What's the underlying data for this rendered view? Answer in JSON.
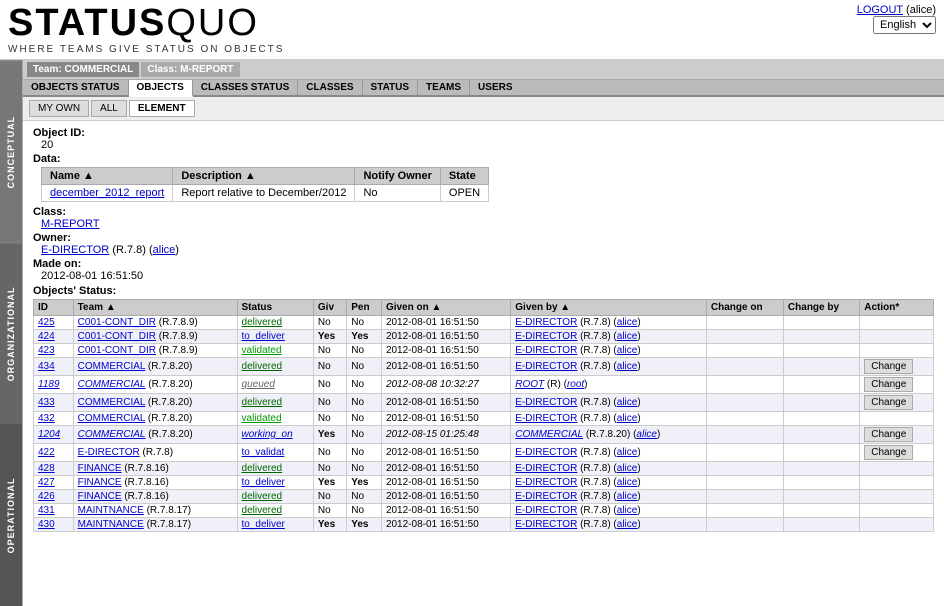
{
  "app": {
    "logo_status": "STATUS",
    "logo_quo": "QUO",
    "tagline": "WHERE TEAMS GIVE STATUS ON OBJECTS",
    "logout_label": "LOGOUT",
    "user": "alice",
    "language": "English"
  },
  "nav_info": {
    "team_label": "Team: COMMERCIAL",
    "class_label": "Class: M-REPORT"
  },
  "nav_tabs": [
    {
      "id": "objects-status",
      "label": "OBJECTS STATUS",
      "active": false
    },
    {
      "id": "objects",
      "label": "OBJECTS",
      "active": true
    },
    {
      "id": "classes-status",
      "label": "CLASSES STATUS",
      "active": false
    },
    {
      "id": "classes",
      "label": "CLASSES",
      "active": false
    },
    {
      "id": "status",
      "label": "STATUS",
      "active": false
    },
    {
      "id": "teams",
      "label": "TEAMS",
      "active": false
    },
    {
      "id": "users",
      "label": "USERS",
      "active": false
    }
  ],
  "sub_tabs": [
    {
      "id": "my-own",
      "label": "MY OWN",
      "active": false
    },
    {
      "id": "all",
      "label": "ALL",
      "active": false
    },
    {
      "id": "element",
      "label": "ELEMENT",
      "active": true
    }
  ],
  "object_detail": {
    "object_id_label": "Object ID:",
    "object_id_value": "20",
    "data_label": "Data:",
    "name_col": "Name",
    "description_col": "Description",
    "notify_owner_col": "Notify Owner",
    "state_col": "State",
    "object_name": "december_2012_report",
    "object_description": "Report relative to December/2012",
    "object_notify": "No",
    "object_state": "OPEN",
    "class_label": "Class:",
    "class_value": "M-REPORT",
    "owner_label": "Owner:",
    "owner_team": "E-DIRECTOR",
    "owner_version": "(R.7.8)",
    "owner_user": "alice",
    "made_on_label": "Made on:",
    "made_on_value": "2012-08-01 16:51:50",
    "objects_status_label": "Objects' Status:"
  },
  "status_table": {
    "columns": [
      "ID",
      "Team",
      "Status",
      "Giv",
      "Pen",
      "Given on",
      "Given by",
      "Change on",
      "Change by",
      "Action*"
    ],
    "rows": [
      {
        "id": "425",
        "team": "C001-CONT_DIR",
        "team_ver": "(R.7.8.9)",
        "status": "delivered",
        "giv": "No",
        "pen": "No",
        "given_on": "2012-08-01 16:51:50",
        "given_by": "E-DIRECTOR",
        "given_by_ver": "(R.7.8)",
        "given_by_user": "alice",
        "change_on": "",
        "change_by": "",
        "has_action": false
      },
      {
        "id": "424",
        "team": "C001-CONT_DIR",
        "team_ver": "(R.7.8.9)",
        "status": "to_deliver",
        "giv": "Yes",
        "pen": "Yes",
        "given_on": "2012-08-01 16:51:50",
        "given_by": "E-DIRECTOR",
        "given_by_ver": "(R.7.8)",
        "given_by_user": "alice",
        "change_on": "",
        "change_by": "",
        "has_action": false
      },
      {
        "id": "423",
        "team": "C001-CONT_DIR",
        "team_ver": "(R.7.8.9)",
        "status": "validated",
        "giv": "No",
        "pen": "No",
        "given_on": "2012-08-01 16:51:50",
        "given_by": "E-DIRECTOR",
        "given_by_ver": "(R.7.8)",
        "given_by_user": "alice",
        "change_on": "",
        "change_by": "",
        "has_action": false
      },
      {
        "id": "434",
        "team": "COMMERCIAL",
        "team_ver": "(R.7.8.20)",
        "status": "delivered",
        "giv": "No",
        "pen": "No",
        "given_on": "2012-08-01 16:51:50",
        "given_by": "E-DIRECTOR",
        "given_by_ver": "(R.7.8)",
        "given_by_user": "alice",
        "change_on": "",
        "change_by": "",
        "has_action": true,
        "action_label": "Change"
      },
      {
        "id": "1189",
        "team": "COMMERCIAL",
        "team_ver": "(R.7.8.20)",
        "status": "queued",
        "giv": "No",
        "pen": "No",
        "given_on": "2012-08-08 10:32:27",
        "given_by": "ROOT",
        "given_by_ver": "(R)",
        "given_by_user": "root",
        "change_on": "",
        "change_by": "",
        "has_action": true,
        "action_label": "Change",
        "italic": true
      },
      {
        "id": "433",
        "team": "COMMERCIAL",
        "team_ver": "(R.7.8.20)",
        "status": "delivered",
        "giv": "No",
        "pen": "No",
        "given_on": "2012-08-01 16:51:50",
        "given_by": "E-DIRECTOR",
        "given_by_ver": "(R.7.8)",
        "given_by_user": "alice",
        "change_on": "",
        "change_by": "",
        "has_action": true,
        "action_label": "Change"
      },
      {
        "id": "432",
        "team": "COMMERCIAL",
        "team_ver": "(R.7.8.20)",
        "status": "validated",
        "giv": "No",
        "pen": "No",
        "given_on": "2012-08-01 16:51:50",
        "given_by": "E-DIRECTOR",
        "given_by_ver": "(R.7.8)",
        "given_by_user": "alice",
        "change_on": "",
        "change_by": "",
        "has_action": false
      },
      {
        "id": "1204",
        "team": "COMMERCIAL",
        "team_ver": "(R.7.8.20)",
        "status": "working_on",
        "giv": "Yes",
        "pen": "No",
        "given_on": "2012-08-15 01:25:48",
        "given_by": "COMMERCIAL",
        "given_by_ver": "(R.7.8.20)",
        "given_by_user": "alice",
        "change_on": "",
        "change_by": "",
        "has_action": true,
        "action_label": "Change",
        "italic": true
      },
      {
        "id": "422",
        "team": "E-DIRECTOR",
        "team_ver": "(R.7.8)",
        "status": "to_validat",
        "giv": "No",
        "pen": "No",
        "given_on": "2012-08-01 16:51:50",
        "given_by": "E-DIRECTOR",
        "given_by_ver": "(R.7.8)",
        "given_by_user": "alice",
        "change_on": "",
        "change_by": "",
        "has_action": true,
        "action_label": "Change"
      },
      {
        "id": "428",
        "team": "FINANCE",
        "team_ver": "(R.7.8.16)",
        "status": "delivered",
        "giv": "No",
        "pen": "No",
        "given_on": "2012-08-01 16:51:50",
        "given_by": "E-DIRECTOR",
        "given_by_ver": "(R.7.8)",
        "given_by_user": "alice",
        "change_on": "",
        "change_by": "",
        "has_action": false
      },
      {
        "id": "427",
        "team": "FINANCE",
        "team_ver": "(R.7.8.16)",
        "status": "to_deliver",
        "giv": "Yes",
        "pen": "Yes",
        "given_on": "2012-08-01 16:51:50",
        "given_by": "E-DIRECTOR",
        "given_by_ver": "(R.7.8)",
        "given_by_user": "alice",
        "change_on": "",
        "change_by": "",
        "has_action": false
      },
      {
        "id": "426",
        "team": "FINANCE",
        "team_ver": "(R.7.8.16)",
        "status": "delivered",
        "giv": "No",
        "pen": "No",
        "given_on": "2012-08-01 16:51:50",
        "given_by": "E-DIRECTOR",
        "given_by_ver": "(R.7.8)",
        "given_by_user": "alice",
        "change_on": "",
        "change_by": "",
        "has_action": false
      },
      {
        "id": "431",
        "team": "MAINTNANCE",
        "team_ver": "(R.7.8.17)",
        "status": "delivered",
        "giv": "No",
        "pen": "No",
        "given_on": "2012-08-01 16:51:50",
        "given_by": "E-DIRECTOR",
        "given_by_ver": "(R.7.8)",
        "given_by_user": "alice",
        "change_on": "",
        "change_by": "",
        "has_action": false
      },
      {
        "id": "430",
        "team": "MAINTNANCE",
        "team_ver": "(R.7.8.17)",
        "status": "to_deliver",
        "giv": "Yes",
        "pen": "Yes",
        "given_on": "2012-08-01 16:51:50",
        "given_by": "E-DIRECTOR",
        "given_by_ver": "(R.7.8)",
        "given_by_user": "alice",
        "change_on": "",
        "change_by": "",
        "has_action": false
      }
    ],
    "change_btn_label": "Change"
  },
  "sidebar": {
    "labels": [
      "CONCEPTUAL",
      "ORGANIZATIONAL",
      "OPERATIONAL"
    ]
  }
}
